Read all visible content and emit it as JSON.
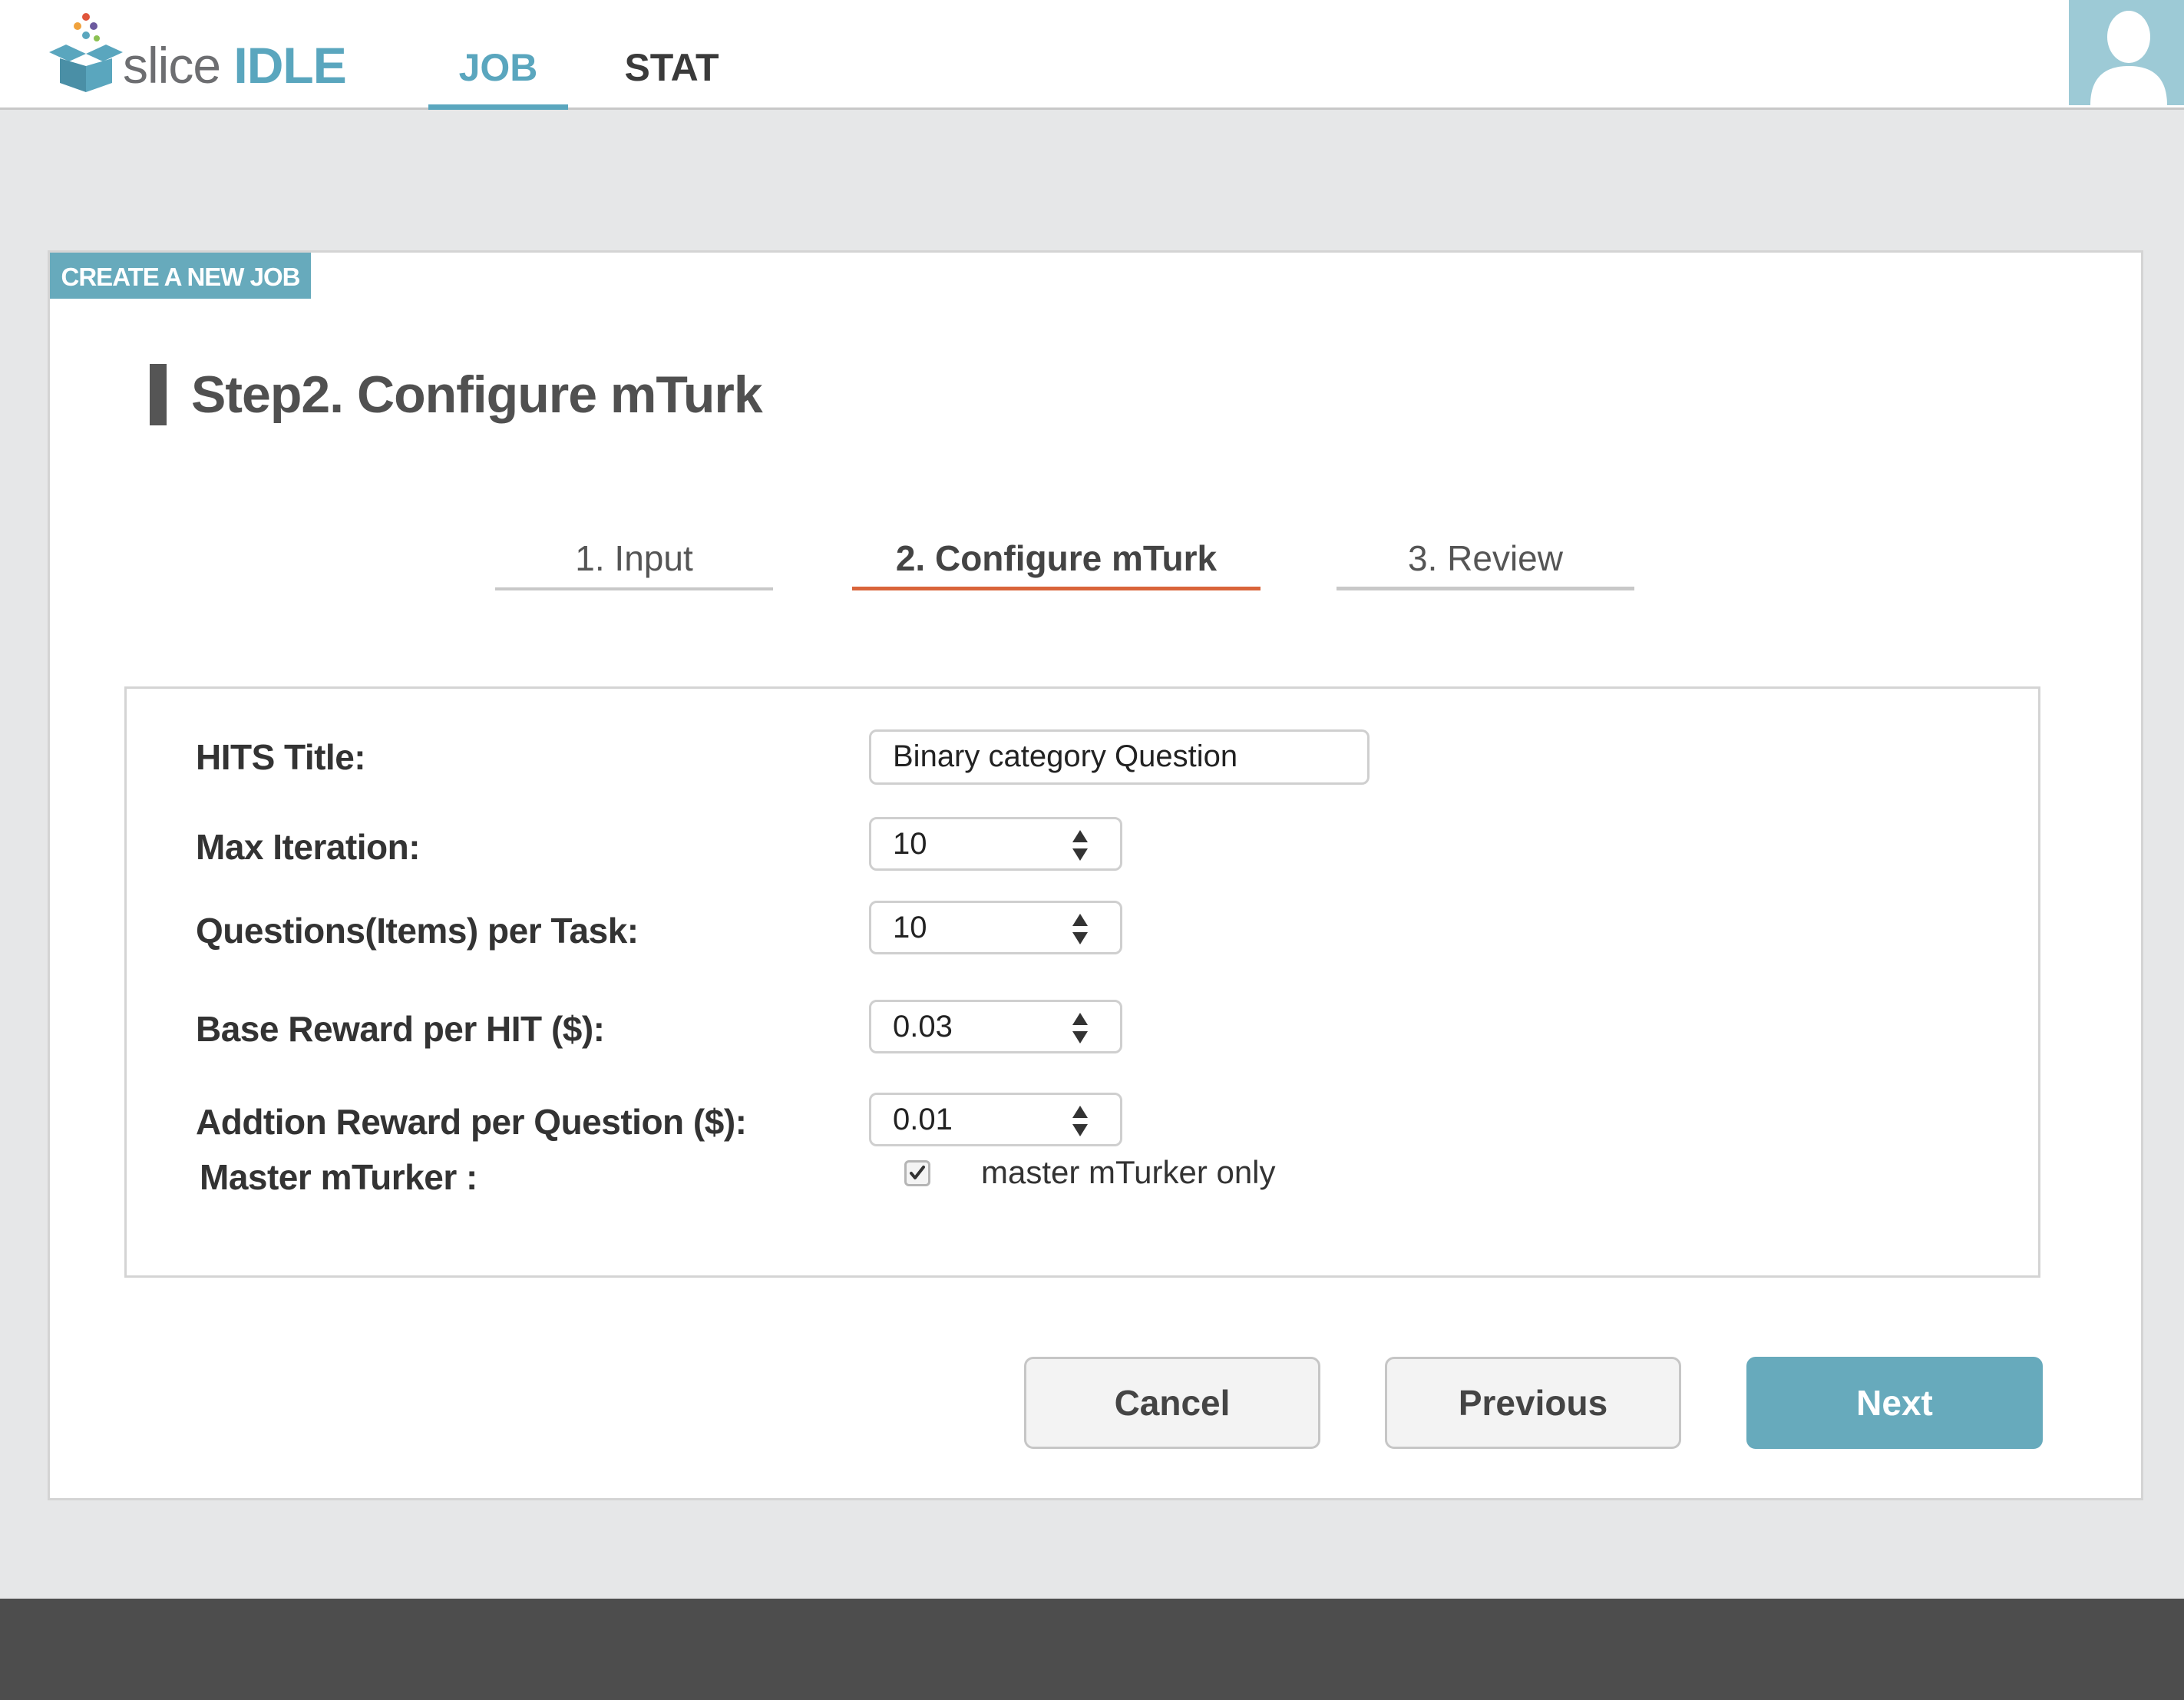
{
  "app": {
    "logo_text_1": "slice",
    "logo_text_2": "IDLE",
    "accent_color": "#5aa6be",
    "active_step_color": "#d9643a"
  },
  "nav": {
    "tabs": [
      {
        "label": "JOB",
        "active": true
      },
      {
        "label": "STAT",
        "active": false
      }
    ],
    "avatar_icon": "user-silhouette-icon"
  },
  "card": {
    "tag": "CREATE A NEW JOB",
    "heading": "Step2. Configure mTurk"
  },
  "wizard": {
    "steps": [
      {
        "label": "1. Input",
        "active": false
      },
      {
        "label": "2.  Configure mTurk",
        "active": true
      },
      {
        "label": "3. Review",
        "active": false
      }
    ]
  },
  "form": {
    "hits_title": {
      "label": "HITS Title:",
      "value": "Binary category Question"
    },
    "max_iteration": {
      "label": "Max Iteration:",
      "value": "10"
    },
    "questions_per_task": {
      "label": "Questions(Items) per Task:",
      "value": "10"
    },
    "base_reward": {
      "label": "Base Reward per HIT ($):",
      "value": "0.03"
    },
    "additional_reward": {
      "label": "Addtion Reward per Question ($):",
      "value": "0.01"
    },
    "master_mturker": {
      "label": "Master mTurker :",
      "checkbox_label": "master mTurker only",
      "checked": true
    }
  },
  "buttons": {
    "cancel": "Cancel",
    "previous": "Previous",
    "next": "Next"
  }
}
